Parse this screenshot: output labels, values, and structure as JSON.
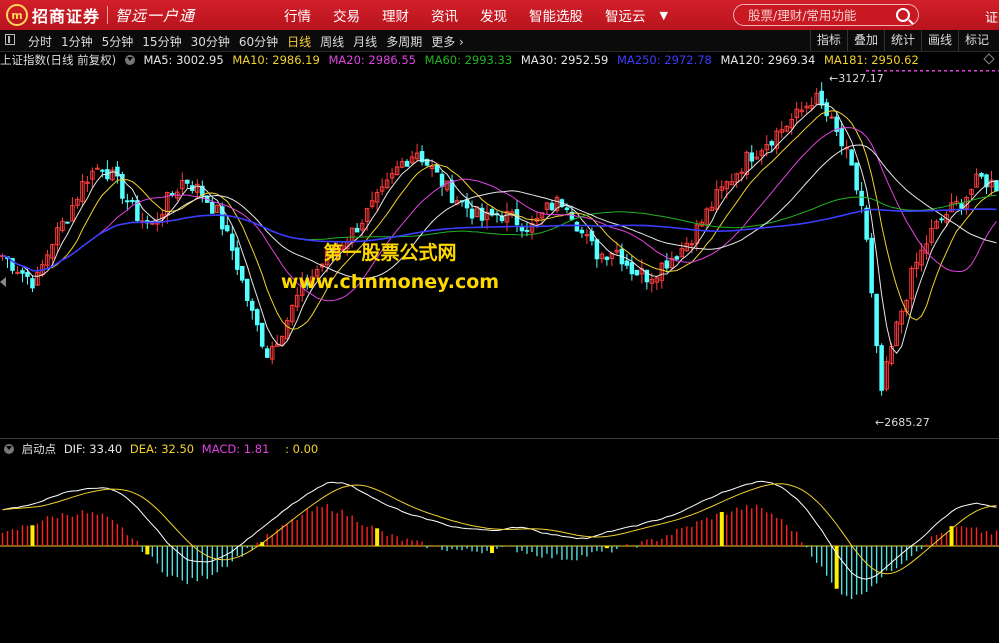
{
  "app": {
    "logo_mark": "m",
    "logo_text": "招商证券",
    "slogan": "智远一户通",
    "nav": [
      "行情",
      "交易",
      "理财",
      "资讯",
      "发现",
      "智能选股",
      "智远云"
    ],
    "search_placeholder": "股票/理财/常用功能",
    "top_right": "证"
  },
  "toolbar": {
    "periods": [
      "分时",
      "1分钟",
      "5分钟",
      "15分钟",
      "30分钟",
      "60分钟",
      "日线",
      "周线",
      "月线",
      "多周期",
      "更多"
    ],
    "active_period": "日线",
    "tools": [
      "指标",
      "叠加",
      "统计",
      "画线",
      "标记"
    ]
  },
  "main_legend": {
    "name": "上证指数(日线 前复权)",
    "ma": [
      {
        "label": "MA5: 3002.95",
        "color": "#e8e8e8"
      },
      {
        "label": "MA10: 2986.19",
        "color": "#f2d22e"
      },
      {
        "label": "MA20: 2986.55",
        "color": "#e043e0"
      },
      {
        "label": "MA60: 2993.33",
        "color": "#22b422"
      },
      {
        "label": "MA30: 2952.59",
        "color": "#e8e8e8"
      },
      {
        "label": "MA250: 2972.78",
        "color": "#3c3cff"
      },
      {
        "label": "MA120: 2969.34",
        "color": "#e8e8e8"
      },
      {
        "label": "MA181: 2950.62",
        "color": "#f2d22e"
      }
    ],
    "high_label": "3127.17",
    "low_label": "2685.27"
  },
  "macd_legend": {
    "name": "启动点",
    "items": [
      {
        "label": "DIF: 33.40",
        "color": "#e8e8e8"
      },
      {
        "label": "DEA: 32.50",
        "color": "#f2d22e"
      },
      {
        "label": "MACD: 1.81",
        "color": "#e043e0"
      },
      {
        "label": ": 0.00",
        "color": "#f2d22e"
      }
    ]
  },
  "watermark": {
    "line1": "第一股票公式网",
    "line2": "www.chnmoney.com"
  },
  "chart_data": {
    "type": "line",
    "title": "上证指数(日线 前复权)",
    "price_high": 3127.17,
    "price_low": 2685.27,
    "close_trend": [
      2900,
      2880,
      2860,
      2920,
      2960,
      3010,
      3030,
      3000,
      2960,
      2940,
      2980,
      3010,
      2990,
      2960,
      2900,
      2820,
      2760,
      2800,
      2850,
      2880,
      2910,
      2930,
      2960,
      2990,
      3030,
      3050,
      3020,
      2990,
      2970,
      2950,
      2960,
      2950,
      2940,
      2970,
      2980,
      2930,
      2900,
      2910,
      2880,
      2870,
      2890,
      2910,
      2940,
      2980,
      3010,
      3040,
      3060,
      3080,
      3100,
      3127,
      3090,
      3040,
      2960,
      2700,
      2800,
      2880,
      2930,
      2960,
      2980,
      3010,
      3000
    ],
    "macd_trend": [
      10,
      18,
      25,
      30,
      32,
      28,
      15,
      -5,
      -25,
      -35,
      -30,
      -18,
      -5,
      8,
      20,
      32,
      38,
      30,
      20,
      10,
      5,
      0,
      -3,
      -5,
      -4,
      -2,
      -6,
      -10,
      -12,
      -8,
      -4,
      0,
      5,
      12,
      20,
      28,
      34,
      38,
      30,
      15,
      -10,
      -40,
      -50,
      -35,
      -20,
      -5,
      10,
      18,
      15,
      12
    ]
  }
}
